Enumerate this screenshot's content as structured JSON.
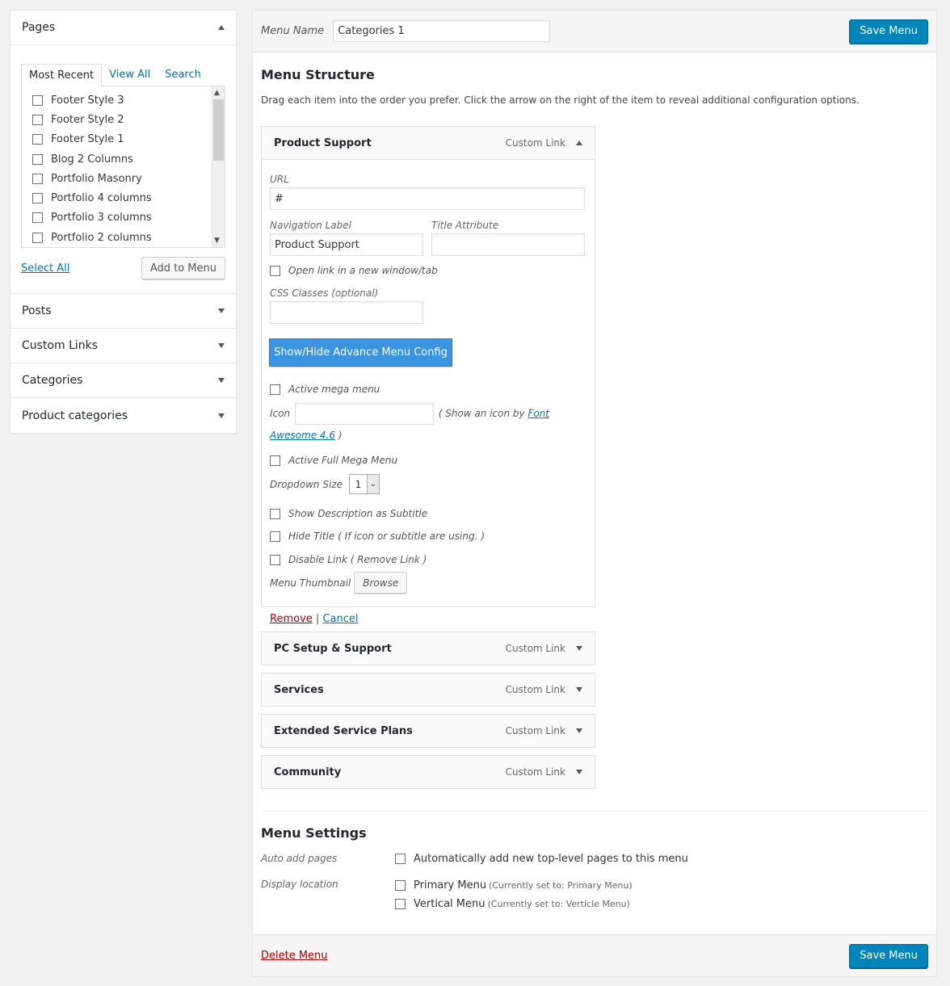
{
  "sidebar": {
    "pages": {
      "title": "Pages",
      "tabs": [
        "Most Recent",
        "View All",
        "Search"
      ],
      "items": [
        "Footer Style 3",
        "Footer Style 2",
        "Footer Style 1",
        "Blog 2 Columns",
        "Portfolio Masonry",
        "Portfolio 4 columns",
        "Portfolio 3 columns",
        "Portfolio 2 columns"
      ],
      "select_all": "Select All",
      "add_to_menu": "Add to Menu"
    },
    "sections": [
      "Posts",
      "Custom Links",
      "Categories",
      "Product categories"
    ]
  },
  "header": {
    "menu_name_label": "Menu Name",
    "menu_name_value": "Categories 1",
    "save_label": "Save Menu"
  },
  "structure": {
    "title": "Menu Structure",
    "description": "Drag each item into the order you prefer. Click the arrow on the right of the item to reveal additional configuration options.",
    "expanded_item": {
      "title": "Product Support",
      "type": "Custom Link",
      "url_label": "URL",
      "url_value": "#",
      "nav_label": "Navigation Label",
      "nav_value": "Product Support",
      "title_attr_label": "Title Attribute",
      "new_window_label": "Open link in a new window/tab",
      "css_label": "CSS Classes (optional)",
      "advance_button": "Show/Hide Advance Menu Config",
      "active_mega": "Active mega menu",
      "icon_label": "Icon",
      "icon_hint_pre": "( Show an icon by",
      "icon_hint_link": "Font Awesome 4.6",
      "icon_hint_post": ")",
      "full_mega": "Active Full Mega Menu",
      "dropdown_label": "Dropdown Size",
      "dropdown_value": "1",
      "show_desc": "Show Description as Subtitle",
      "hide_title": "Hide Title ( If icon or subtitle are using. )",
      "disable_link": "Disable Link ( Remove Link )",
      "thumb_label": "Menu Thumbnail",
      "browse": "Browse",
      "remove": "Remove",
      "separator": "|",
      "cancel": "Cancel"
    },
    "items": [
      {
        "title": "PC Setup & Support",
        "type": "Custom Link"
      },
      {
        "title": "Services",
        "type": "Custom Link"
      },
      {
        "title": "Extended Service Plans",
        "type": "Custom Link"
      },
      {
        "title": "Community",
        "type": "Custom Link"
      }
    ]
  },
  "settings": {
    "title": "Menu Settings",
    "auto_add_label": "Auto add pages",
    "auto_add_text": "Automatically add new top-level pages to this menu",
    "display_label": "Display location",
    "locations": [
      {
        "name": "Primary Menu",
        "note": "(Currently set to: Primary Menu)"
      },
      {
        "name": "Vertical Menu",
        "note": "(Currently set to: Verticle Menu)"
      }
    ]
  },
  "footer": {
    "delete": "Delete Menu",
    "save_label": "Save Menu"
  },
  "colors": {
    "primary": "#0085ba",
    "advance_button": "#3a94e0",
    "delete_link": "#a00"
  }
}
